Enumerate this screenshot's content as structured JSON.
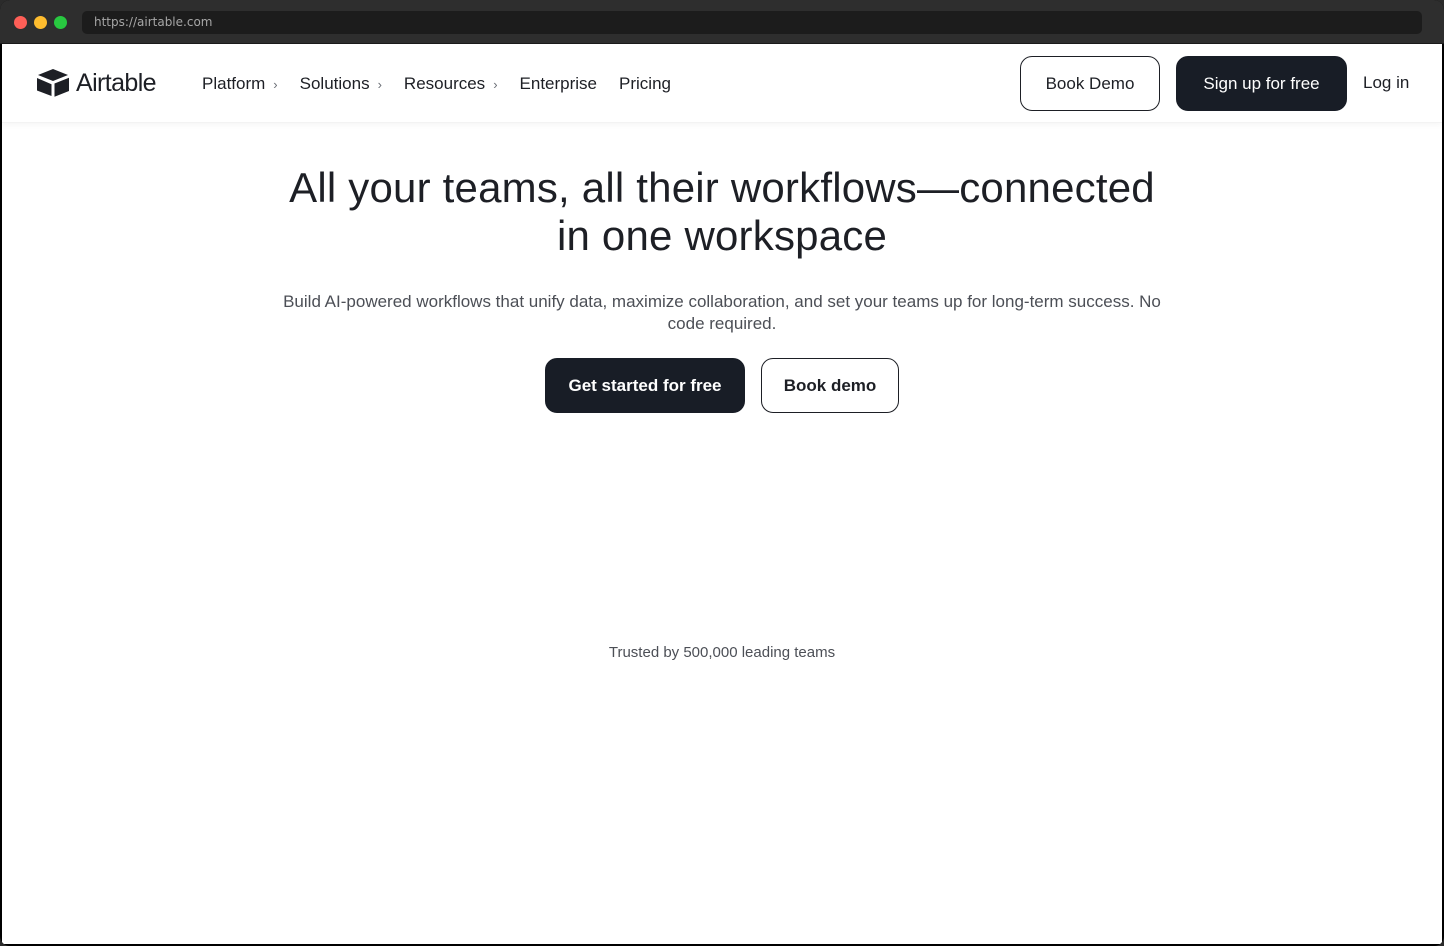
{
  "browser": {
    "url": "https://airtable.com"
  },
  "nav": {
    "brand": "Airtable",
    "links": [
      {
        "label": "Platform",
        "has_submenu": true
      },
      {
        "label": "Solutions",
        "has_submenu": true
      },
      {
        "label": "Resources",
        "has_submenu": true
      },
      {
        "label": "Enterprise",
        "has_submenu": false
      },
      {
        "label": "Pricing",
        "has_submenu": false
      }
    ],
    "book_demo_label": "Book Demo",
    "signup_label": "Sign up for free",
    "login_label": "Log in"
  },
  "hero": {
    "title_line1": "All your teams, all their workflows—connected",
    "title_line2": "in one workspace",
    "subtitle": "Build AI-powered workflows that unify data, maximize collaboration, and set your teams up for long-term success. No code required.",
    "cta_primary": "Get started for free",
    "cta_secondary": "Book demo"
  },
  "social_proof": {
    "text": "Trusted by 500,000 leading teams"
  },
  "colors": {
    "primary_dark": "#181d26",
    "text": "#1d1f25",
    "muted_text": "#4c4f56",
    "background": "#ffffff"
  },
  "icons": {
    "logo": "airtable-logo-icon",
    "submenu": "chevron-right-icon"
  }
}
